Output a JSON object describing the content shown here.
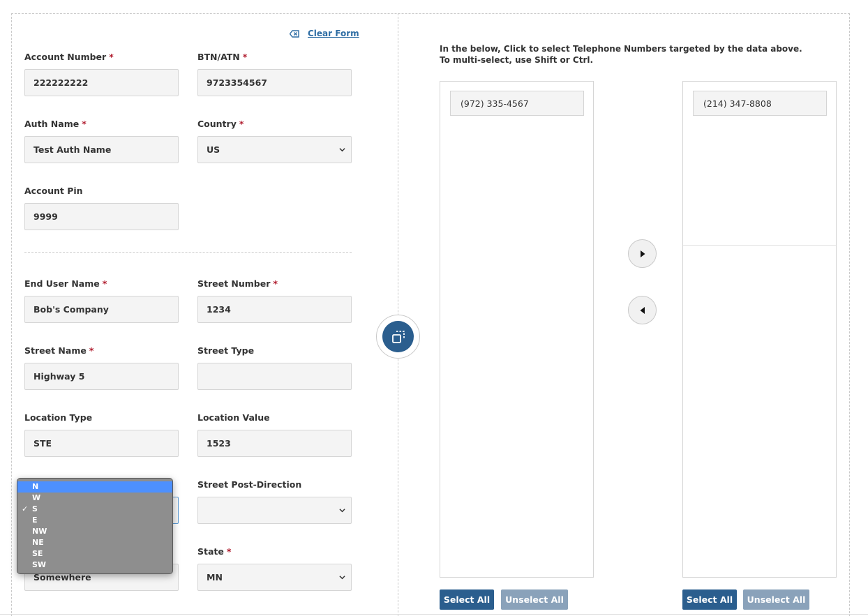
{
  "form": {
    "clear_form": "Clear Form",
    "required_mark": "*",
    "account_number": {
      "label": "Account Number",
      "value": "222222222"
    },
    "btn_atn": {
      "label": "BTN/ATN",
      "value": "9723354567"
    },
    "auth_name": {
      "label": "Auth Name",
      "value": "Test Auth Name"
    },
    "country": {
      "label": "Country",
      "value": "US"
    },
    "account_pin": {
      "label": "Account Pin",
      "value": "9999"
    },
    "end_user_name": {
      "label": "End User Name",
      "value": "Bob's Company"
    },
    "street_number": {
      "label": "Street Number",
      "value": "1234"
    },
    "street_name": {
      "label": "Street Name",
      "value": "Highway 5"
    },
    "street_type": {
      "label": "Street Type",
      "value": ""
    },
    "location_type": {
      "label": "Location Type",
      "value": "STE"
    },
    "location_value": {
      "label": "Location Value",
      "value": "1523"
    },
    "street_post_direction": {
      "label": "Street Post-Direction",
      "value": ""
    },
    "city": {
      "value": "Somewhere"
    },
    "state": {
      "label": "State",
      "value": "MN"
    }
  },
  "pre_direction_dropdown": {
    "options": [
      "N",
      "W",
      "S",
      "E",
      "NW",
      "NE",
      "SE",
      "SW"
    ],
    "selected": "S",
    "highlighted": "N",
    "check_glyph": "✓"
  },
  "tn_selector": {
    "instruction_line1": "In the below, Click to select Telephone Numbers targeted by the data above.",
    "instruction_line2": "To multi-select, use Shift or Ctrl.",
    "available": [
      "(972) 335-4567"
    ],
    "selected": [
      "(214) 347-8808"
    ],
    "select_all": "Select All",
    "unselect_all": "Unselect All"
  },
  "colors": {
    "primary": "#2b5e8e",
    "secondary": "#8aa2ba",
    "required": "#b01c2e",
    "link": "#2e6da4"
  }
}
